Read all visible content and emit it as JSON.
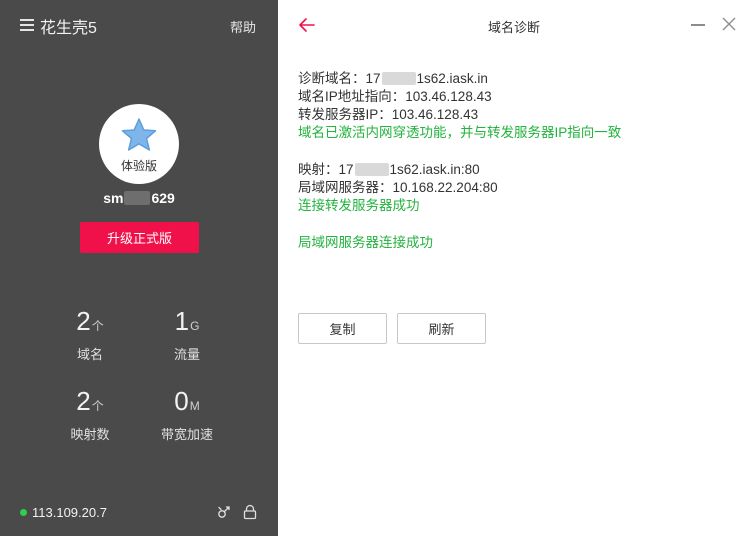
{
  "sidebar": {
    "app_title": "花生壳5",
    "help": "帮助",
    "avatar_label": "体验版",
    "username_prefix": "sm",
    "username_suffix": "629",
    "upgrade_label": "升级正式版",
    "stats": [
      {
        "value": "2",
        "unit": "个",
        "label": "域名"
      },
      {
        "value": "1",
        "unit": "G",
        "label": "流量"
      },
      {
        "value": "2",
        "unit": "个",
        "label": "映射数"
      },
      {
        "value": "0",
        "unit": "M",
        "label": "带宽加速"
      }
    ],
    "ip": "113.109.20.7",
    "status_color": "#2fd050"
  },
  "main": {
    "title": "域名诊断",
    "lines": {
      "l1_prefix": "诊断域名：17",
      "l1_suffix": "1s62.iask.in",
      "l2": "域名IP地址指向：103.46.128.43",
      "l3": "转发服务器IP：103.46.128.43",
      "l4": "域名已激活内网穿透功能，并与转发服务器IP指向一致",
      "l5_prefix": "映射：17",
      "l5_suffix": "1s62.iask.in:80",
      "l6": "局域网服务器：10.168.22.204:80",
      "l7": "连接转发服务器成功",
      "l8": "局域网服务器连接成功"
    },
    "copy_label": "复制",
    "refresh_label": "刷新"
  },
  "colors": {
    "accent": "#f0114b",
    "success": "#23b33f",
    "sidebar_bg": "#4a4a4a"
  }
}
